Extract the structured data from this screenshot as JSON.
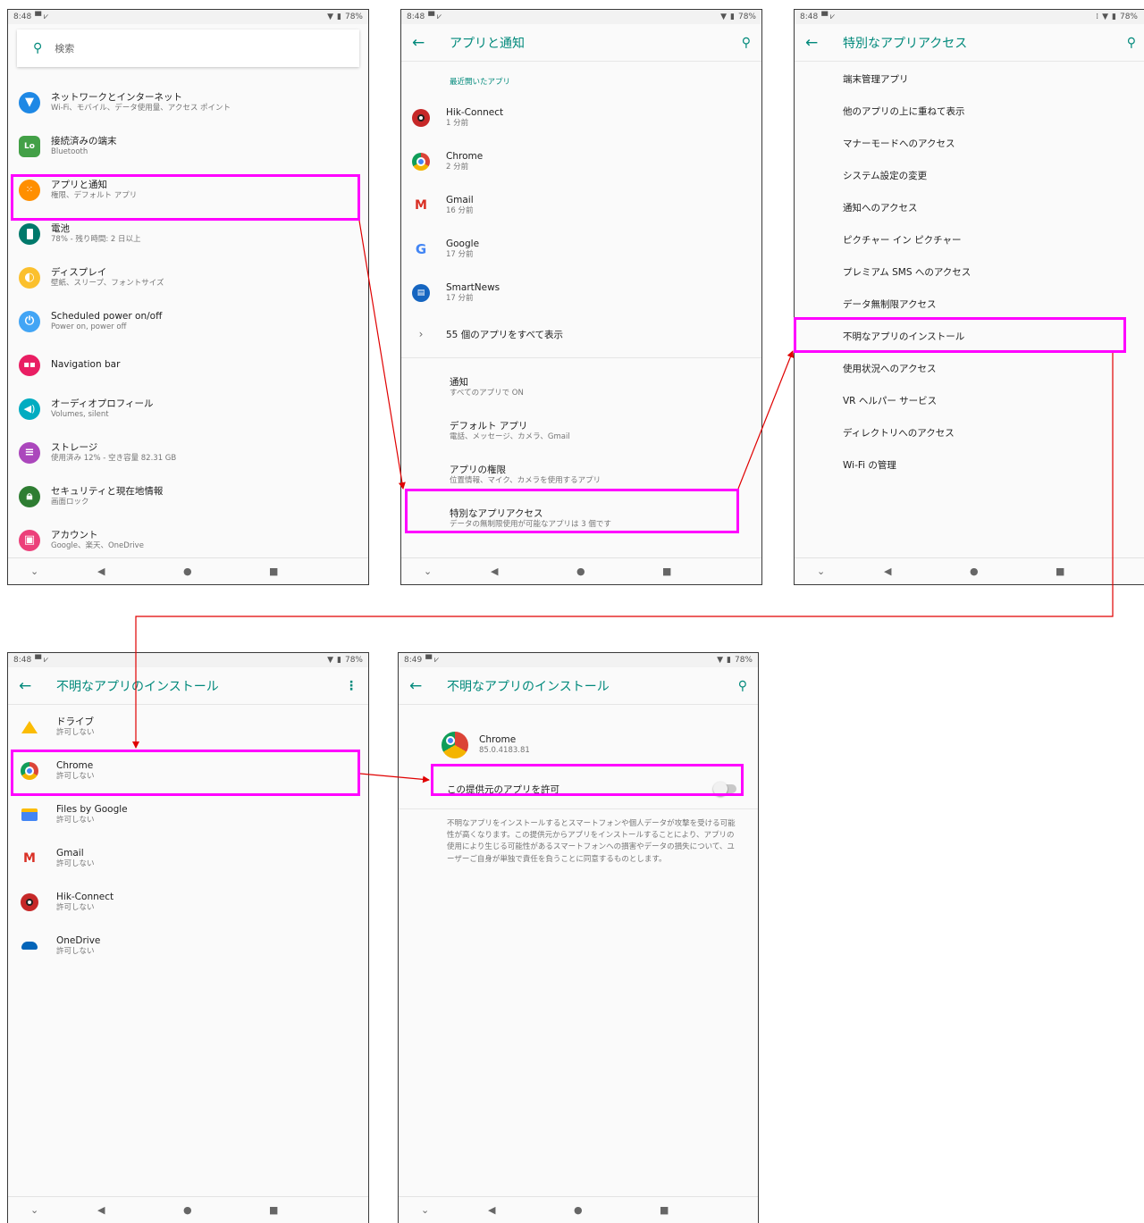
{
  "status": {
    "time_a": "8:48",
    "time_b": "8:49",
    "battery": "78%"
  },
  "s1": {
    "search_placeholder": "検索",
    "items": [
      {
        "title": "ネットワークとインターネット",
        "sub": "Wi-Fi、モバイル、データ使用量、アクセス ポイント"
      },
      {
        "title": "接続済みの端末",
        "sub": "Bluetooth"
      },
      {
        "title": "アプリと通知",
        "sub": "権限、デフォルト アプリ"
      },
      {
        "title": "電池",
        "sub": "78% - 残り時間: 2 日以上"
      },
      {
        "title": "ディスプレイ",
        "sub": "壁紙、スリープ、フォントサイズ"
      },
      {
        "title": "Scheduled power on/off",
        "sub": "Power on, power off"
      },
      {
        "title": "Navigation bar",
        "sub": ""
      },
      {
        "title": "オーディオプロフィール",
        "sub": "Volumes, silent"
      },
      {
        "title": "ストレージ",
        "sub": "使用済み 12% - 空き容量 82.31 GB"
      },
      {
        "title": "セキュリティと現在地情報",
        "sub": "画面ロック"
      },
      {
        "title": "アカウント",
        "sub": "Google、楽天、OneDrive"
      }
    ]
  },
  "s2": {
    "title": "アプリと通知",
    "recent_label": "最近開いたアプリ",
    "recent": [
      {
        "name": "Hik-Connect",
        "time": "1 分前"
      },
      {
        "name": "Chrome",
        "time": "2 分前"
      },
      {
        "name": "Gmail",
        "time": "16 分前"
      },
      {
        "name": "Google",
        "time": "17 分前"
      },
      {
        "name": "SmartNews",
        "time": "17 分前"
      }
    ],
    "show_all": "55 個のアプリをすべて表示",
    "items": [
      {
        "title": "通知",
        "sub": "すべてのアプリで ON"
      },
      {
        "title": "デフォルト アプリ",
        "sub": "電話、メッセージ、カメラ、Gmail"
      },
      {
        "title": "アプリの権限",
        "sub": "位置情報、マイク、カメラを使用するアプリ"
      },
      {
        "title": "特別なアプリアクセス",
        "sub": "データの無制限使用が可能なアプリは 3 個です"
      }
    ]
  },
  "s3": {
    "title": "特別なアプリアクセス",
    "items": [
      "端末管理アプリ",
      "他のアプリの上に重ねて表示",
      "マナーモードへのアクセス",
      "システム設定の変更",
      "通知へのアクセス",
      "ピクチャー イン ピクチャー",
      "プレミアム SMS へのアクセス",
      "データ無制限アクセス",
      "不明なアプリのインストール",
      "使用状況へのアクセス",
      "VR ヘルパー サービス",
      "ディレクトリへのアクセス",
      "Wi-Fi の管理"
    ]
  },
  "s4": {
    "title": "不明なアプリのインストール",
    "apps": [
      {
        "name": "ドライブ",
        "status": "許可しない"
      },
      {
        "name": "Chrome",
        "status": "許可しない"
      },
      {
        "name": "Files by Google",
        "status": "許可しない"
      },
      {
        "name": "Gmail",
        "status": "許可しない"
      },
      {
        "name": "Hik-Connect",
        "status": "許可しない"
      },
      {
        "name": "OneDrive",
        "status": "許可しない"
      }
    ]
  },
  "s5": {
    "title": "不明なアプリのインストール",
    "app_name": "Chrome",
    "app_version": "85.0.4183.81",
    "toggle_label": "この提供元のアプリを許可",
    "toggle_on": false,
    "warning": "不明なアプリをインストールするとスマートフォンや個人データが攻撃を受ける可能性が高くなります。この提供元からアプリをインストールすることにより、アプリの使用により生じる可能性があるスマートフォンへの損害やデータの損失について、ユーザーご自身が単独で責任を負うことに同意するものとします。"
  },
  "colors": {
    "accent": "#00897b",
    "highlight": "#ff00ff",
    "arrow": "#e00000"
  }
}
